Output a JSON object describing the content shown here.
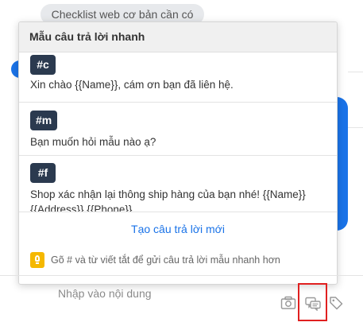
{
  "chat": {
    "chip_label": "Checklist web cơ bản cần có",
    "input_placeholder": "Nhập vào nội dung"
  },
  "quick_reply": {
    "title": "Mẫu câu trả lời nhanh",
    "items": [
      {
        "shortcut": "#c",
        "text": "Xin chào {{Name}}, cám ơn bạn đã liên hệ."
      },
      {
        "shortcut": "#m",
        "text": "Bạn muốn hỏi mẫu nào ạ?"
      },
      {
        "shortcut": "#f",
        "text": "Shop xác nhận lại thông ship hàng của bạn nhé! {{Name}} {{Address}} {{Phone}}"
      }
    ],
    "create_new_label": "Tạo câu trả lời mới",
    "hint": "Gõ # và từ viết tắt để gửi câu trả lời mẫu nhanh hơn"
  },
  "toolbar": {
    "icons": [
      "camera-icon",
      "quick-reply-icon",
      "tag-icon"
    ]
  },
  "colors": {
    "accent": "#1a73e8",
    "badge_bg": "#2b3a4f",
    "highlight_border": "#e02020",
    "hint_icon": "#f5b800"
  }
}
